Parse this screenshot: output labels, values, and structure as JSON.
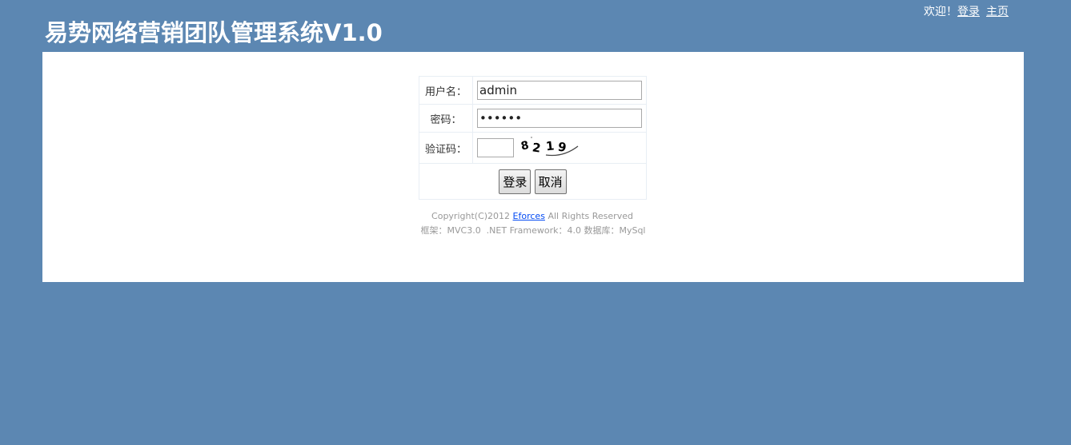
{
  "topnav": {
    "welcome": "欢迎！",
    "login_link": "登录",
    "home_link": "主页"
  },
  "header": {
    "title": "易势网络营销团队管理系统V1.0"
  },
  "login_form": {
    "username_label": "用户名：",
    "username_value": "admin",
    "password_label": "密码：",
    "password_value": "123456",
    "captcha_label": "验证码：",
    "captcha_value": "",
    "captcha_text": "8219",
    "login_button": "登录",
    "cancel_button": "取消"
  },
  "footer": {
    "copyright_prefix": "Copyright(C)2012",
    "company_link": "Eforces",
    "copyright_suffix": "All Rights Reserved",
    "tech_info": "框架：MVC3.0  .NET Framework：4.0 数据库：MySql"
  },
  "colors": {
    "background": "#5c87b2",
    "panel": "#ffffff",
    "link": "#034af3"
  }
}
